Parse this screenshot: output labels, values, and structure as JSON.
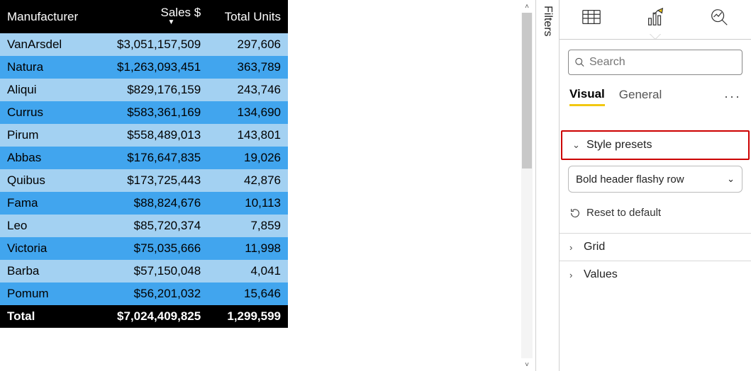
{
  "table": {
    "columns": [
      "Manufacturer",
      "Sales $",
      "Total Units"
    ],
    "sort_column_index": 1,
    "rows": [
      {
        "m": "VanArsdel",
        "s": "$3,051,157,509",
        "u": "297,606"
      },
      {
        "m": "Natura",
        "s": "$1,263,093,451",
        "u": "363,789"
      },
      {
        "m": "Aliqui",
        "s": "$829,176,159",
        "u": "243,746"
      },
      {
        "m": "Currus",
        "s": "$583,361,169",
        "u": "134,690"
      },
      {
        "m": "Pirum",
        "s": "$558,489,013",
        "u": "143,801"
      },
      {
        "m": "Abbas",
        "s": "$176,647,835",
        "u": "19,026"
      },
      {
        "m": "Quibus",
        "s": "$173,725,443",
        "u": "42,876"
      },
      {
        "m": "Fama",
        "s": "$88,824,676",
        "u": "10,113"
      },
      {
        "m": "Leo",
        "s": "$85,720,374",
        "u": "7,859"
      },
      {
        "m": "Victoria",
        "s": "$75,035,666",
        "u": "11,998"
      },
      {
        "m": "Barba",
        "s": "$57,150,048",
        "u": "4,041"
      },
      {
        "m": "Pomum",
        "s": "$56,201,032",
        "u": "15,646"
      }
    ],
    "total_label": "Total",
    "total_sales": "$7,024,409,825",
    "total_units": "1,299,599"
  },
  "filters_label": "Filters",
  "pane": {
    "search_placeholder": "Search",
    "subtabs": {
      "visual": "Visual",
      "general": "General"
    },
    "sections": {
      "style_presets": "Style presets",
      "grid": "Grid",
      "values": "Values"
    },
    "preset_value": "Bold header flashy row",
    "reset_label": "Reset to default"
  }
}
